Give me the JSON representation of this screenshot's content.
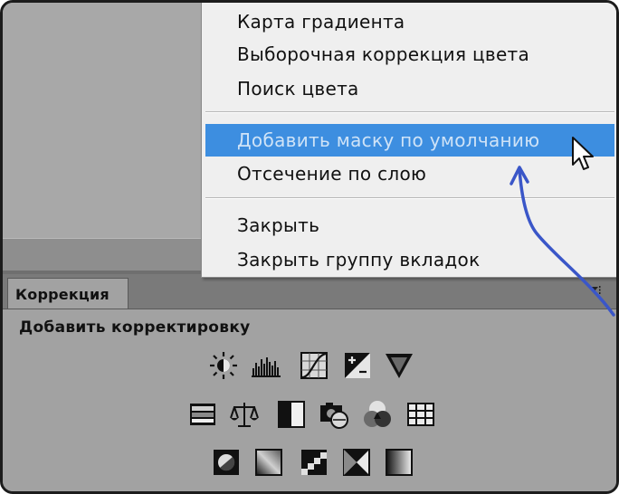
{
  "menu": {
    "items": [
      {
        "label": "Карта градиента"
      },
      {
        "label": "Выборочная коррекция цвета"
      },
      {
        "label": "Поиск цвета"
      },
      {
        "label": "Добавить маску по умолчанию"
      },
      {
        "label": "Отсечение по слою"
      },
      {
        "label": "Закрыть"
      },
      {
        "label": "Закрыть группу вкладок"
      }
    ],
    "highlighted_item": "Добавить маску по умолчанию"
  },
  "panel": {
    "tab_label": "Коррекция",
    "heading": "Добавить корректировку",
    "icons": {
      "row1": [
        "brightness-contrast-icon",
        "levels-icon",
        "curves-icon",
        "exposure-icon",
        "vibrance-icon"
      ],
      "row2": [
        "hue-saturation-icon",
        "color-balance-icon",
        "black-white-icon",
        "photo-filter-icon",
        "channel-mixer-icon",
        "color-lookup-icon"
      ],
      "row3": [
        "invert-icon",
        "posterize-icon",
        "threshold-icon",
        "selective-color-icon",
        "gradient-map-icon"
      ]
    }
  },
  "colors": {
    "highlight": "#3d8ee0",
    "annotation_arrow": "#3a56c8",
    "panel_bg": "#a2a2a2"
  }
}
